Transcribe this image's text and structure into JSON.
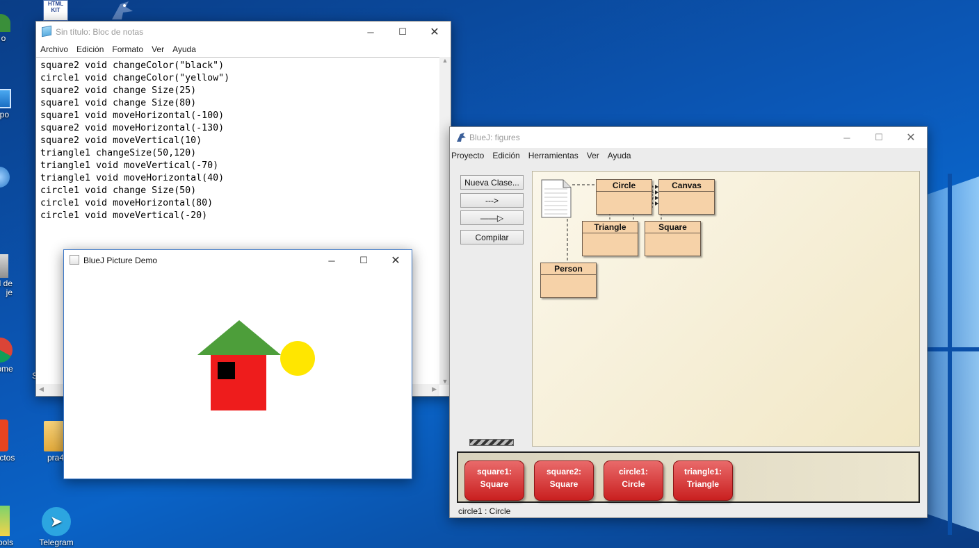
{
  "desktop": {
    "icons": [
      {
        "label": "o",
        "name": "desktop-icon-user"
      },
      {
        "label": "ipo",
        "name": "desktop-icon-equipo"
      },
      {
        "label": "",
        "name": "desktop-icon-network"
      },
      {
        "label": "l de\nje",
        "name": "desktop-icon-recycle"
      },
      {
        "label": "rome",
        "name": "desktop-icon-chrome"
      },
      {
        "label": "S",
        "name": "desktop-icon-s"
      },
      {
        "label": "rectos",
        "name": "desktop-icon-directos"
      },
      {
        "label": "pra4",
        "name": "desktop-icon-pra4"
      },
      {
        "label": "Tools",
        "name": "desktop-icon-tools"
      },
      {
        "label": "Telegram",
        "name": "desktop-icon-telegram"
      }
    ],
    "htmlkit_text": "HTML\nKIT"
  },
  "notepad": {
    "title": "Sin título: Bloc de notas",
    "menu": [
      "Archivo",
      "Edición",
      "Formato",
      "Ver",
      "Ayuda"
    ],
    "lines": [
      "square2 void changeColor(\"black\")",
      "circle1 void changeColor(\"yellow\")",
      "square2 void change Size(25)",
      "square1 void change Size(80)",
      "square1 void moveHorizontal(-100)",
      "square2 void moveHorizontal(-130)",
      "square2 void moveVertical(10)",
      "triangle1 changeSize(50,120)",
      "triangle1 void moveVertical(-70)",
      "triangle1 void moveHorizontal(40)",
      "circle1 void change Size(50)",
      "circle1 void moveHorizontal(80)",
      "circle1 void moveVertical(-20)"
    ]
  },
  "picture_demo": {
    "title": "BlueJ Picture Demo",
    "colors": {
      "wall": "#ee1c1c",
      "window": "#000000",
      "roof": "#4d9e3a",
      "sun": "#ffe600"
    }
  },
  "bluej": {
    "title": "BlueJ:  figures",
    "menu": [
      "Proyecto",
      "Edición",
      "Herramientas",
      "Ver",
      "Ayuda"
    ],
    "buttons": {
      "new_class": "Nueva Clase...",
      "dep_arrow": "--->",
      "inh_arrow": "——▷",
      "compile": "Compilar"
    },
    "classes": {
      "circle": "Circle",
      "canvas": "Canvas",
      "triangle": "Triangle",
      "square": "Square",
      "person": "Person"
    },
    "objects": [
      {
        "line1": "square1:",
        "line2": "Square"
      },
      {
        "line1": "square2:",
        "line2": "Square"
      },
      {
        "line1": "circle1:",
        "line2": "Circle"
      },
      {
        "line1": "triangle1:",
        "line2": "Triangle"
      }
    ],
    "status": "circle1 : Circle"
  }
}
